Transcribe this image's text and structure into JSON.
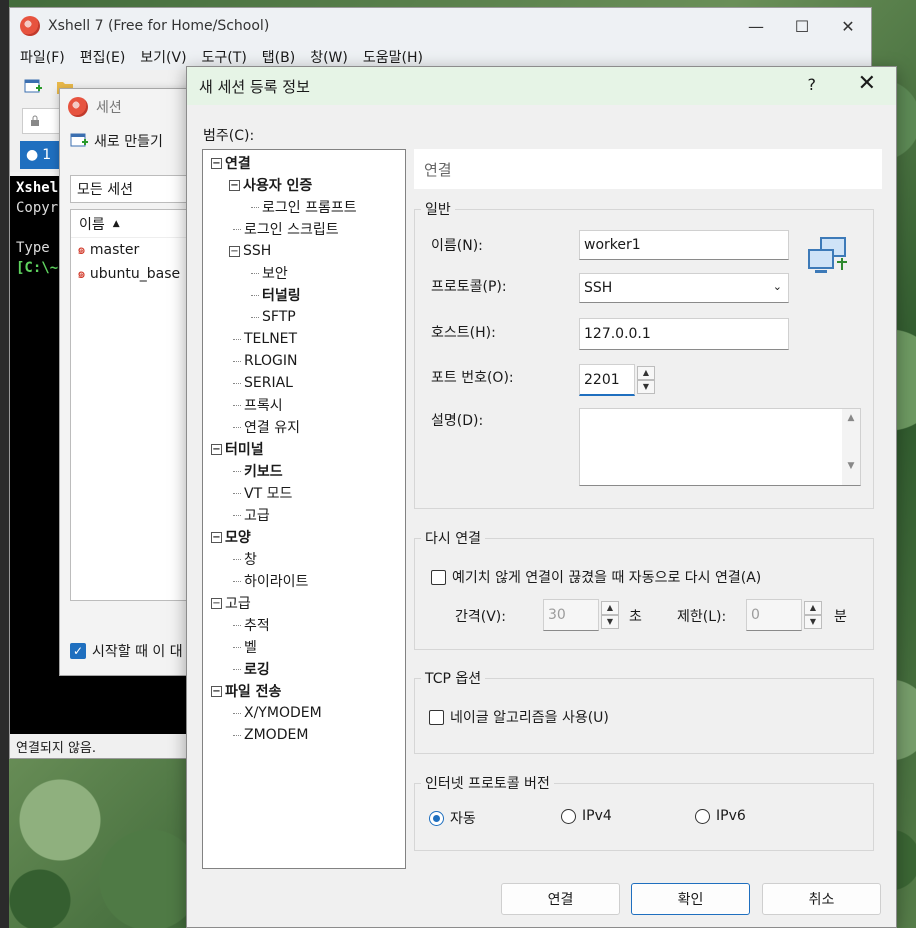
{
  "app": {
    "title": "Xshell 7 (Free for Home/School)",
    "menu": [
      "파일(F)",
      "편집(E)",
      "보기(V)",
      "도구(T)",
      "탭(B)",
      "창(W)",
      "도움말(H)"
    ],
    "tab_label": "1",
    "terminal_lines": [
      "Xshel",
      "Copyr",
      "",
      "Type",
      "[C:\\~"
    ],
    "status": "연결되지 않음."
  },
  "sessions": {
    "title": "세션",
    "new_label": "새로 만들기",
    "filter": "모든 세션",
    "column": "이름",
    "items": [
      "master",
      "ubuntu_base"
    ],
    "startup_check": "시작할 때 이 대"
  },
  "dialog": {
    "title": "새 세션 등록 정보",
    "help": "?",
    "category_label": "범주(C):",
    "tree": [
      {
        "label": "연결",
        "level": 0,
        "bold": true
      },
      {
        "label": "사용자 인증",
        "level": 1,
        "bold": true
      },
      {
        "label": "로그인 프롬프트",
        "level": 2,
        "bold": false
      },
      {
        "label": "로그인 스크립트",
        "level": 1,
        "bold": false
      },
      {
        "label": "SSH",
        "level": 1,
        "bold": false
      },
      {
        "label": "보안",
        "level": 2,
        "bold": false
      },
      {
        "label": "터널링",
        "level": 2,
        "bold": true
      },
      {
        "label": "SFTP",
        "level": 2,
        "bold": false
      },
      {
        "label": "TELNET",
        "level": 1,
        "bold": false
      },
      {
        "label": "RLOGIN",
        "level": 1,
        "bold": false
      },
      {
        "label": "SERIAL",
        "level": 1,
        "bold": false
      },
      {
        "label": "프록시",
        "level": 1,
        "bold": false
      },
      {
        "label": "연결 유지",
        "level": 1,
        "bold": false
      },
      {
        "label": "터미널",
        "level": 0,
        "bold": true
      },
      {
        "label": "키보드",
        "level": 1,
        "bold": true
      },
      {
        "label": "VT 모드",
        "level": 1,
        "bold": false
      },
      {
        "label": "고급",
        "level": 1,
        "bold": false
      },
      {
        "label": "모양",
        "level": 0,
        "bold": true
      },
      {
        "label": "창",
        "level": 1,
        "bold": false
      },
      {
        "label": "하이라이트",
        "level": 1,
        "bold": false
      },
      {
        "label": "고급",
        "level": 0,
        "bold": false
      },
      {
        "label": "추적",
        "level": 1,
        "bold": false
      },
      {
        "label": "벨",
        "level": 1,
        "bold": false
      },
      {
        "label": "로깅",
        "level": 1,
        "bold": true
      },
      {
        "label": "파일 전송",
        "level": 0,
        "bold": true
      },
      {
        "label": "X/YMODEM",
        "level": 1,
        "bold": false
      },
      {
        "label": "ZMODEM",
        "level": 1,
        "bold": false
      }
    ],
    "panel_title": "연결",
    "general": {
      "title": "일반",
      "name_label": "이름(N):",
      "name_value": "worker1",
      "protocol_label": "프로토콜(P):",
      "protocol_value": "SSH",
      "host_label": "호스트(H):",
      "host_value": "127.0.0.1",
      "port_label": "포트 번호(O):",
      "port_value": "2201",
      "desc_label": "설명(D):"
    },
    "reconnect": {
      "title": "다시 연결",
      "check": "예기치 않게 연결이 끊겼을 때 자동으로 다시 연결(A)",
      "interval_label": "간격(V):",
      "interval_value": "30",
      "interval_unit": "초",
      "limit_label": "제한(L):",
      "limit_value": "0",
      "limit_unit": "분"
    },
    "tcp": {
      "title": "TCP 옵션",
      "check": "네이글 알고리즘을 사용(U)"
    },
    "ipver": {
      "title": "인터넷 프로토콜 버전",
      "options": [
        "자동",
        "IPv4",
        "IPv6"
      ],
      "selected": "자동"
    },
    "buttons": {
      "connect": "연결",
      "ok": "확인",
      "cancel": "취소"
    }
  },
  "colors": {
    "accent": "#1f6fbf",
    "dialog_title_bg": "#e6f4e6"
  }
}
